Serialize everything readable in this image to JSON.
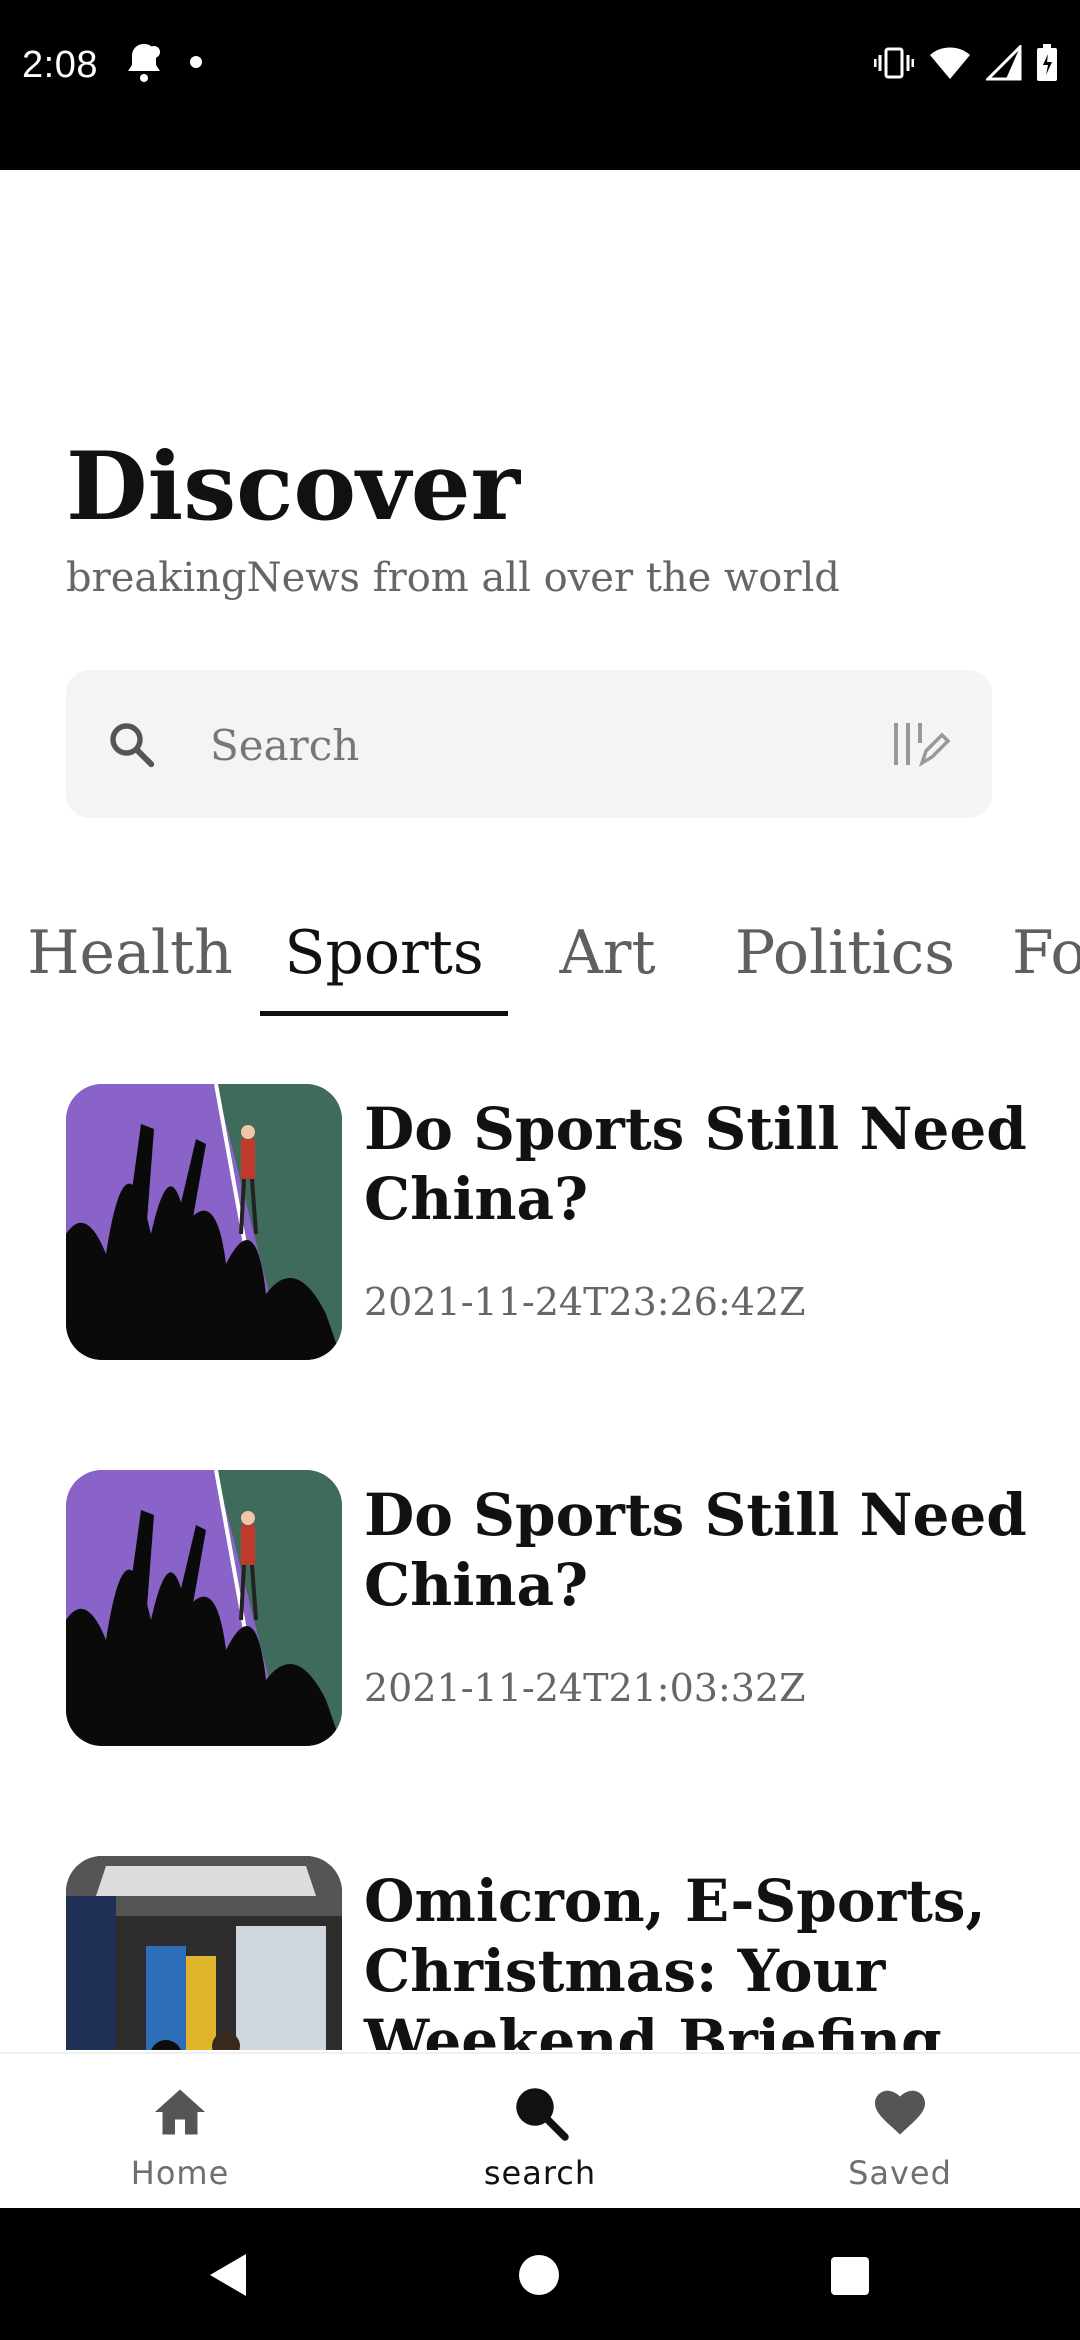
{
  "status_bar": {
    "time": "2:08"
  },
  "header": {
    "title": "Discover",
    "subtitle": "breakingNews from all over the world"
  },
  "search": {
    "placeholder": "Search"
  },
  "tabs": [
    {
      "label": "Health"
    },
    {
      "label": "Sports"
    },
    {
      "label": "Art"
    },
    {
      "label": "Politics"
    },
    {
      "label": "Fo"
    }
  ],
  "active_tab": "Sports",
  "articles": [
    {
      "title": "Do Sports Still Need China?",
      "date": "2021-11-24T23:26:42Z"
    },
    {
      "title": "Do Sports Still Need China?",
      "date": "2021-11-24T21:03:32Z"
    },
    {
      "title": "Omicron, E-Sports, Christmas: Your Weekend Briefing",
      "date": ""
    }
  ],
  "bottom_nav": {
    "items": [
      {
        "label": "Home",
        "icon": "home-icon"
      },
      {
        "label": "search",
        "icon": "search-icon"
      },
      {
        "label": "Saved",
        "icon": "heart-icon"
      }
    ],
    "active": "search"
  },
  "colors": {
    "accent": "#111111",
    "muted": "#666666",
    "search_bg": "#f4f4f4"
  }
}
